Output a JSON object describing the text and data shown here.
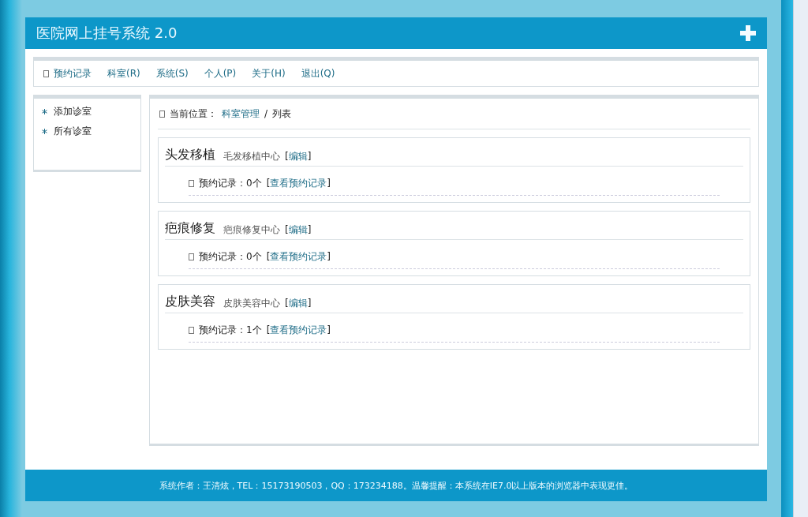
{
  "header": {
    "title": "医院网上挂号系统 2.0"
  },
  "nav": {
    "items": [
      {
        "label": "预约记录",
        "icon": true
      },
      {
        "label": "科室(R)",
        "icon": false
      },
      {
        "label": "系统(S)",
        "icon": false
      },
      {
        "label": "个人(P)",
        "icon": false
      },
      {
        "label": "关于(H)",
        "icon": false
      },
      {
        "label": "退出(Q)",
        "icon": false
      }
    ]
  },
  "sidebar": {
    "items": [
      {
        "label": "添加诊室"
      },
      {
        "label": "所有诊室"
      }
    ]
  },
  "breadcrumb": {
    "label": "当前位置：",
    "link": "科室管理",
    "separator": "/",
    "current": "列表"
  },
  "departments": [
    {
      "name": "头发移植",
      "center": "毛发移植中心",
      "edit": [
        "[",
        "编辑",
        "]"
      ],
      "records_label": "预约记录：0个",
      "records_link": [
        "[",
        "查看预约记录",
        "]"
      ]
    },
    {
      "name": "疤痕修复",
      "center": "疤痕修复中心",
      "edit": [
        "[",
        "编辑",
        "]"
      ],
      "records_label": "预约记录：0个",
      "records_link": [
        "[",
        "查看预约记录",
        "]"
      ]
    },
    {
      "name": "皮肤美容",
      "center": "皮肤美容中心",
      "edit": [
        "[",
        "编辑",
        "]"
      ],
      "records_label": "预约记录：1个",
      "records_link": [
        "[",
        "查看预约记录",
        "]"
      ]
    }
  ],
  "footer": {
    "text": "系统作者：王清炫，TEL：15173190503，QQ：173234188。温馨提醒：本系统在IE7.0以上版本的浏览器中表现更佳。"
  }
}
